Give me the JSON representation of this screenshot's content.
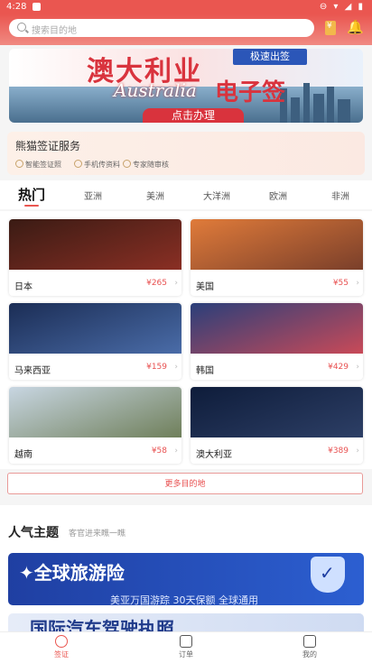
{
  "status_bar": {
    "time": "4:28",
    "icons": "⊖ ▾ ◢ ▮"
  },
  "search": {
    "placeholder": "搜索目的地"
  },
  "header_icons": [
    "coupon-icon",
    "bell-icon"
  ],
  "banner": {
    "title": "澳大利业",
    "badge": "极速出签",
    "script": "Australia",
    "subtitle": "电子签",
    "cta": "点击办理"
  },
  "service": {
    "title": "熊猫签证服务",
    "features": [
      "智能签证照",
      "手机传资料",
      "专家随审核"
    ]
  },
  "tabs": [
    "热门",
    "亚洲",
    "美洲",
    "大洋洲",
    "欧洲",
    "非洲"
  ],
  "destinations": [
    {
      "name": "日本",
      "price": "¥265",
      "colors": [
        "#3a1b14",
        "#8a2f24"
      ]
    },
    {
      "name": "美国",
      "price": "¥55",
      "colors": [
        "#e07b3a",
        "#7a3f2a"
      ]
    },
    {
      "name": "马来西亚",
      "price": "¥159",
      "colors": [
        "#1b2d55",
        "#4a6ca8"
      ]
    },
    {
      "name": "韩国",
      "price": "¥429",
      "colors": [
        "#2a3f7a",
        "#c94a58"
      ]
    },
    {
      "name": "越南",
      "price": "¥58",
      "colors": [
        "#c8d6e2",
        "#6f7f5a"
      ]
    },
    {
      "name": "澳大利亚",
      "price": "¥389",
      "colors": [
        "#0e1c3a",
        "#2d3f66"
      ]
    }
  ],
  "more_button": "更多目的地",
  "popular": {
    "title": "人气主题",
    "subtitle": "客官进来瞧一瞧",
    "insurance_title": "✦全球旅游险",
    "insurance_sub": "美亚万国游踪 30天保额 全球通用",
    "driving_title": "国际汽车驾驶执照"
  },
  "bottom_nav": [
    {
      "label": "签证",
      "active": true
    },
    {
      "label": "订单",
      "active": false
    },
    {
      "label": "我的",
      "active": false
    }
  ],
  "colors": {
    "accent": "#ea5650",
    "price": "#e85050"
  }
}
